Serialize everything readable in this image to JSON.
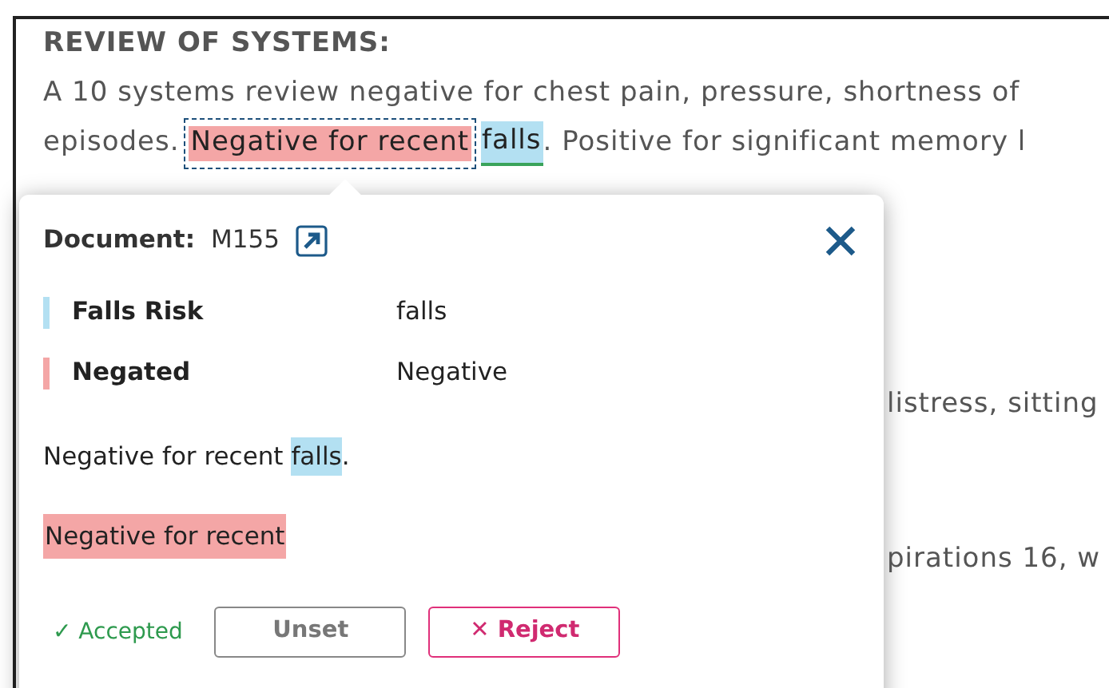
{
  "document": {
    "heading": "REVIEW OF SYSTEMS:",
    "line_1": "A 10 systems review negative for chest pain, pressure, shortness of",
    "line_2": [
      {
        "kind": "text",
        "text": "episodes."
      },
      {
        "kind": "annotation",
        "text": "Negative for recent",
        "color": "#f4a6a6",
        "selected": true
      },
      {
        "kind": "annotation",
        "text": "falls",
        "color": "#b3e0f2",
        "selected": false
      },
      {
        "kind": "text",
        "text": ". Positive for significant memory l"
      }
    ],
    "partial_lines": [
      "listress, sitting",
      "pirations 16, w"
    ]
  },
  "popup": {
    "document_label": "Document:",
    "document_id": "M155",
    "rows": [
      {
        "label": "Falls Risk",
        "value": "falls",
        "color": "#b3e0f2"
      },
      {
        "label": "Negated",
        "value": "Negative",
        "color": "#f4a6a6"
      }
    ],
    "sentence": [
      {
        "text": "Negative for recent "
      },
      {
        "text": "falls",
        "color": "#b3e0f2"
      },
      {
        "text": "."
      }
    ],
    "excerpt": {
      "text": "Negative for recent",
      "color": "#f4a6a6"
    },
    "status": "✓ Accepted",
    "buttons": [
      {
        "label": "Unset",
        "kind": "neutral"
      },
      {
        "label": "✕ Reject",
        "kind": "danger"
      }
    ]
  }
}
